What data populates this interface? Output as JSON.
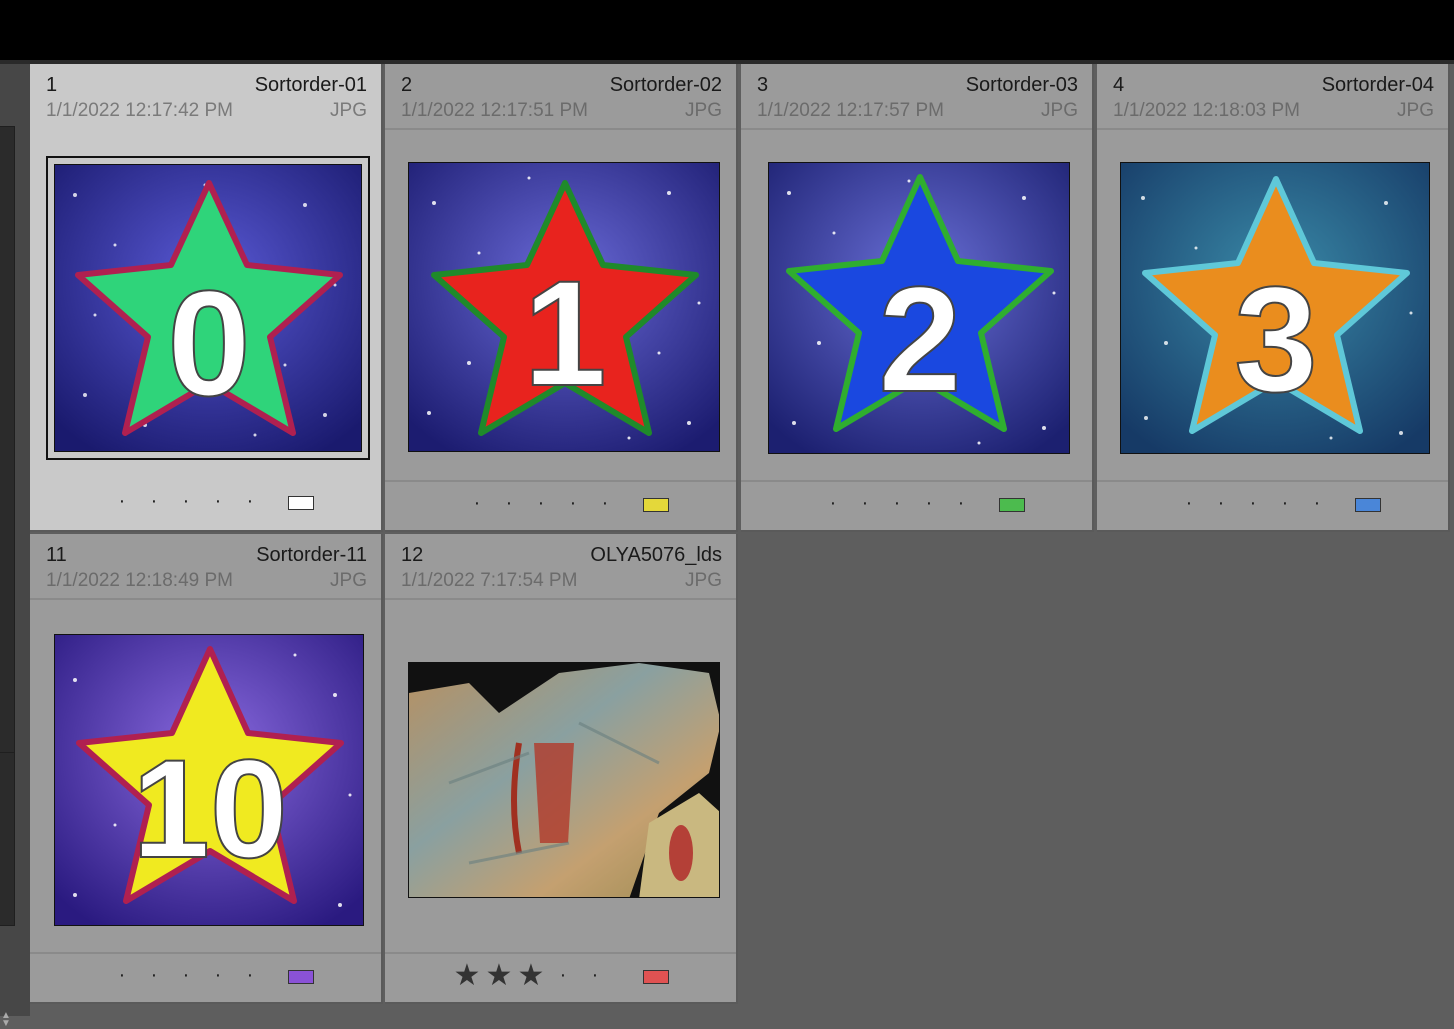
{
  "grid": {
    "cells": [
      {
        "index": "1",
        "filename": "Sortorder-01",
        "date": "1/1/2022 12:17:42 PM",
        "filetype": "JPG",
        "rating_dots": [
          "·",
          "·",
          "·",
          "·",
          "·"
        ],
        "label_color": "#ffffff",
        "star_fill": "#2fd47a",
        "star_outline": "#b02050",
        "digit": "0",
        "bg": "space-blue",
        "selected": true
      },
      {
        "index": "2",
        "filename": "Sortorder-02",
        "date": "1/1/2022 12:17:51 PM",
        "filetype": "JPG",
        "rating_dots": [
          "·",
          "·",
          "·",
          "·",
          "·"
        ],
        "label_color": "#e4d83a",
        "star_fill": "#e8231e",
        "star_outline": "#1f8a2a",
        "digit": "1",
        "bg": "space-blue",
        "selected": false
      },
      {
        "index": "3",
        "filename": "Sortorder-03",
        "date": "1/1/2022 12:17:57 PM",
        "filetype": "JPG",
        "rating_dots": [
          "·",
          "·",
          "·",
          "·",
          "·"
        ],
        "label_color": "#4cbb4e",
        "star_fill": "#1a48e0",
        "star_outline": "#2fae2f",
        "digit": "2",
        "bg": "space-blue",
        "selected": false
      },
      {
        "index": "4",
        "filename": "Sortorder-04",
        "date": "1/1/2022 12:18:03 PM",
        "filetype": "JPG",
        "rating_dots": [
          "·",
          "·",
          "·",
          "·",
          "·"
        ],
        "label_color": "#4a86d8",
        "star_fill": "#ea8d1e",
        "star_outline": "#5fc8d8",
        "digit": "3",
        "bg": "space-teal",
        "selected": false
      },
      {
        "index": "11",
        "filename": "Sortorder-11",
        "date": "1/1/2022 12:18:49 PM",
        "filetype": "JPG",
        "rating_dots": [
          "·",
          "·",
          "·",
          "·",
          "·"
        ],
        "label_color": "#8a52d6",
        "star_fill": "#f0ea20",
        "star_outline": "#b02050",
        "digit": "10",
        "bg": "space-purple",
        "selected": false
      },
      {
        "index": "12",
        "filename": "OLYA5076_lds",
        "date": "1/1/2022 7:17:54 PM",
        "filetype": "JPG",
        "rating_stars": [
          "★",
          "★",
          "★"
        ],
        "rating_dots": [
          "·",
          "·"
        ],
        "label_color": "#e05252",
        "bg": "rock-art",
        "selected": false
      }
    ]
  }
}
